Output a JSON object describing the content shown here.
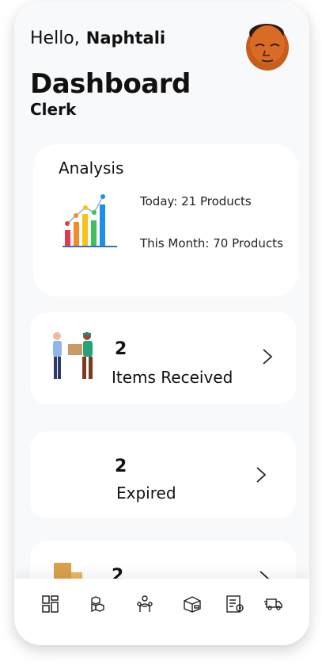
{
  "header": {
    "hello": "Hello,",
    "user_name": "Naphtali",
    "title": "Dashboard",
    "role": "Clerk"
  },
  "analysis": {
    "title": "Analysis",
    "today": "Today: 21 Products",
    "month": "This Month: 70 Products"
  },
  "rows": [
    {
      "count": "2",
      "label": "Items Received"
    },
    {
      "count": "2",
      "label": "Expired"
    },
    {
      "count": "2",
      "label": ""
    }
  ],
  "nav": {
    "icons": [
      "dashboard-icon",
      "boxes-icon",
      "workers-icon",
      "package-icon",
      "inventory-icon",
      "delivery-truck-icon"
    ]
  },
  "colors": {
    "background": "#f8f9fb",
    "card": "#ffffff",
    "text": "#111111"
  }
}
